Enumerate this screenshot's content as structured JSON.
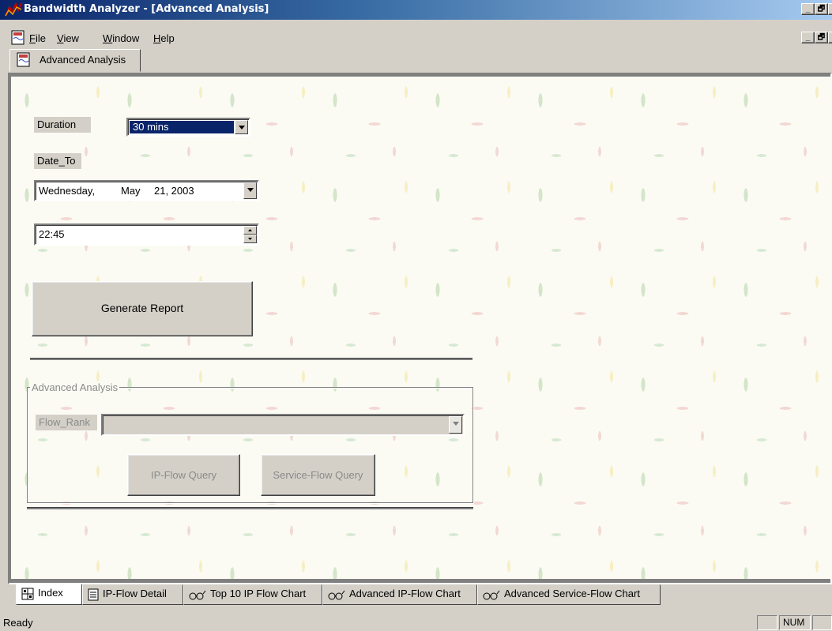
{
  "window": {
    "title": "Bandwidth Analyzer - [Advanced Analysis]",
    "caption_buttons": [
      "_",
      "🗗",
      "x"
    ]
  },
  "menu": {
    "items": [
      {
        "label": "File",
        "mnemonic": "F",
        "rest": "ile"
      },
      {
        "label": "View",
        "mnemonic": "V",
        "rest": "iew"
      },
      {
        "label": "Window",
        "mnemonic": "W",
        "rest": "indow"
      },
      {
        "label": "Help",
        "mnemonic": "H",
        "rest": "elp"
      }
    ]
  },
  "doc_tab": {
    "label": "Advanced Analysis",
    "icon": "doc-icon"
  },
  "form": {
    "duration_label": "Duration",
    "duration_value": "30 mins",
    "date_to_label": "Date_To",
    "date": {
      "weekday": "Wednesday,",
      "month": "May",
      "day_year": "21, 2003"
    },
    "time_value": "22:45",
    "generate_button": "Generate Report"
  },
  "advanced": {
    "group_label": "Advanced Analysis",
    "flow_rank_label": "Flow_Rank",
    "flow_rank_value": "",
    "ip_flow_button": "IP-Flow Query",
    "service_flow_button": "Service-Flow Query"
  },
  "bottom_tabs": [
    {
      "label": "Index",
      "icon": "grid-icon"
    },
    {
      "label": "IP-Flow Detail",
      "icon": "list-icon"
    },
    {
      "label": "Top 10 IP Flow Chart",
      "icon": "glasses-icon"
    },
    {
      "label": "Advanced IP-Flow Chart",
      "icon": "glasses-icon"
    },
    {
      "label": "Advanced Service-Flow Chart",
      "icon": "glasses-icon"
    }
  ],
  "status": {
    "text": "Ready",
    "num": "NUM"
  },
  "colors": {
    "title_start": "#0a246a",
    "title_end": "#a6caf0",
    "face": "#d4d0c8",
    "selection": "#0a246a"
  }
}
